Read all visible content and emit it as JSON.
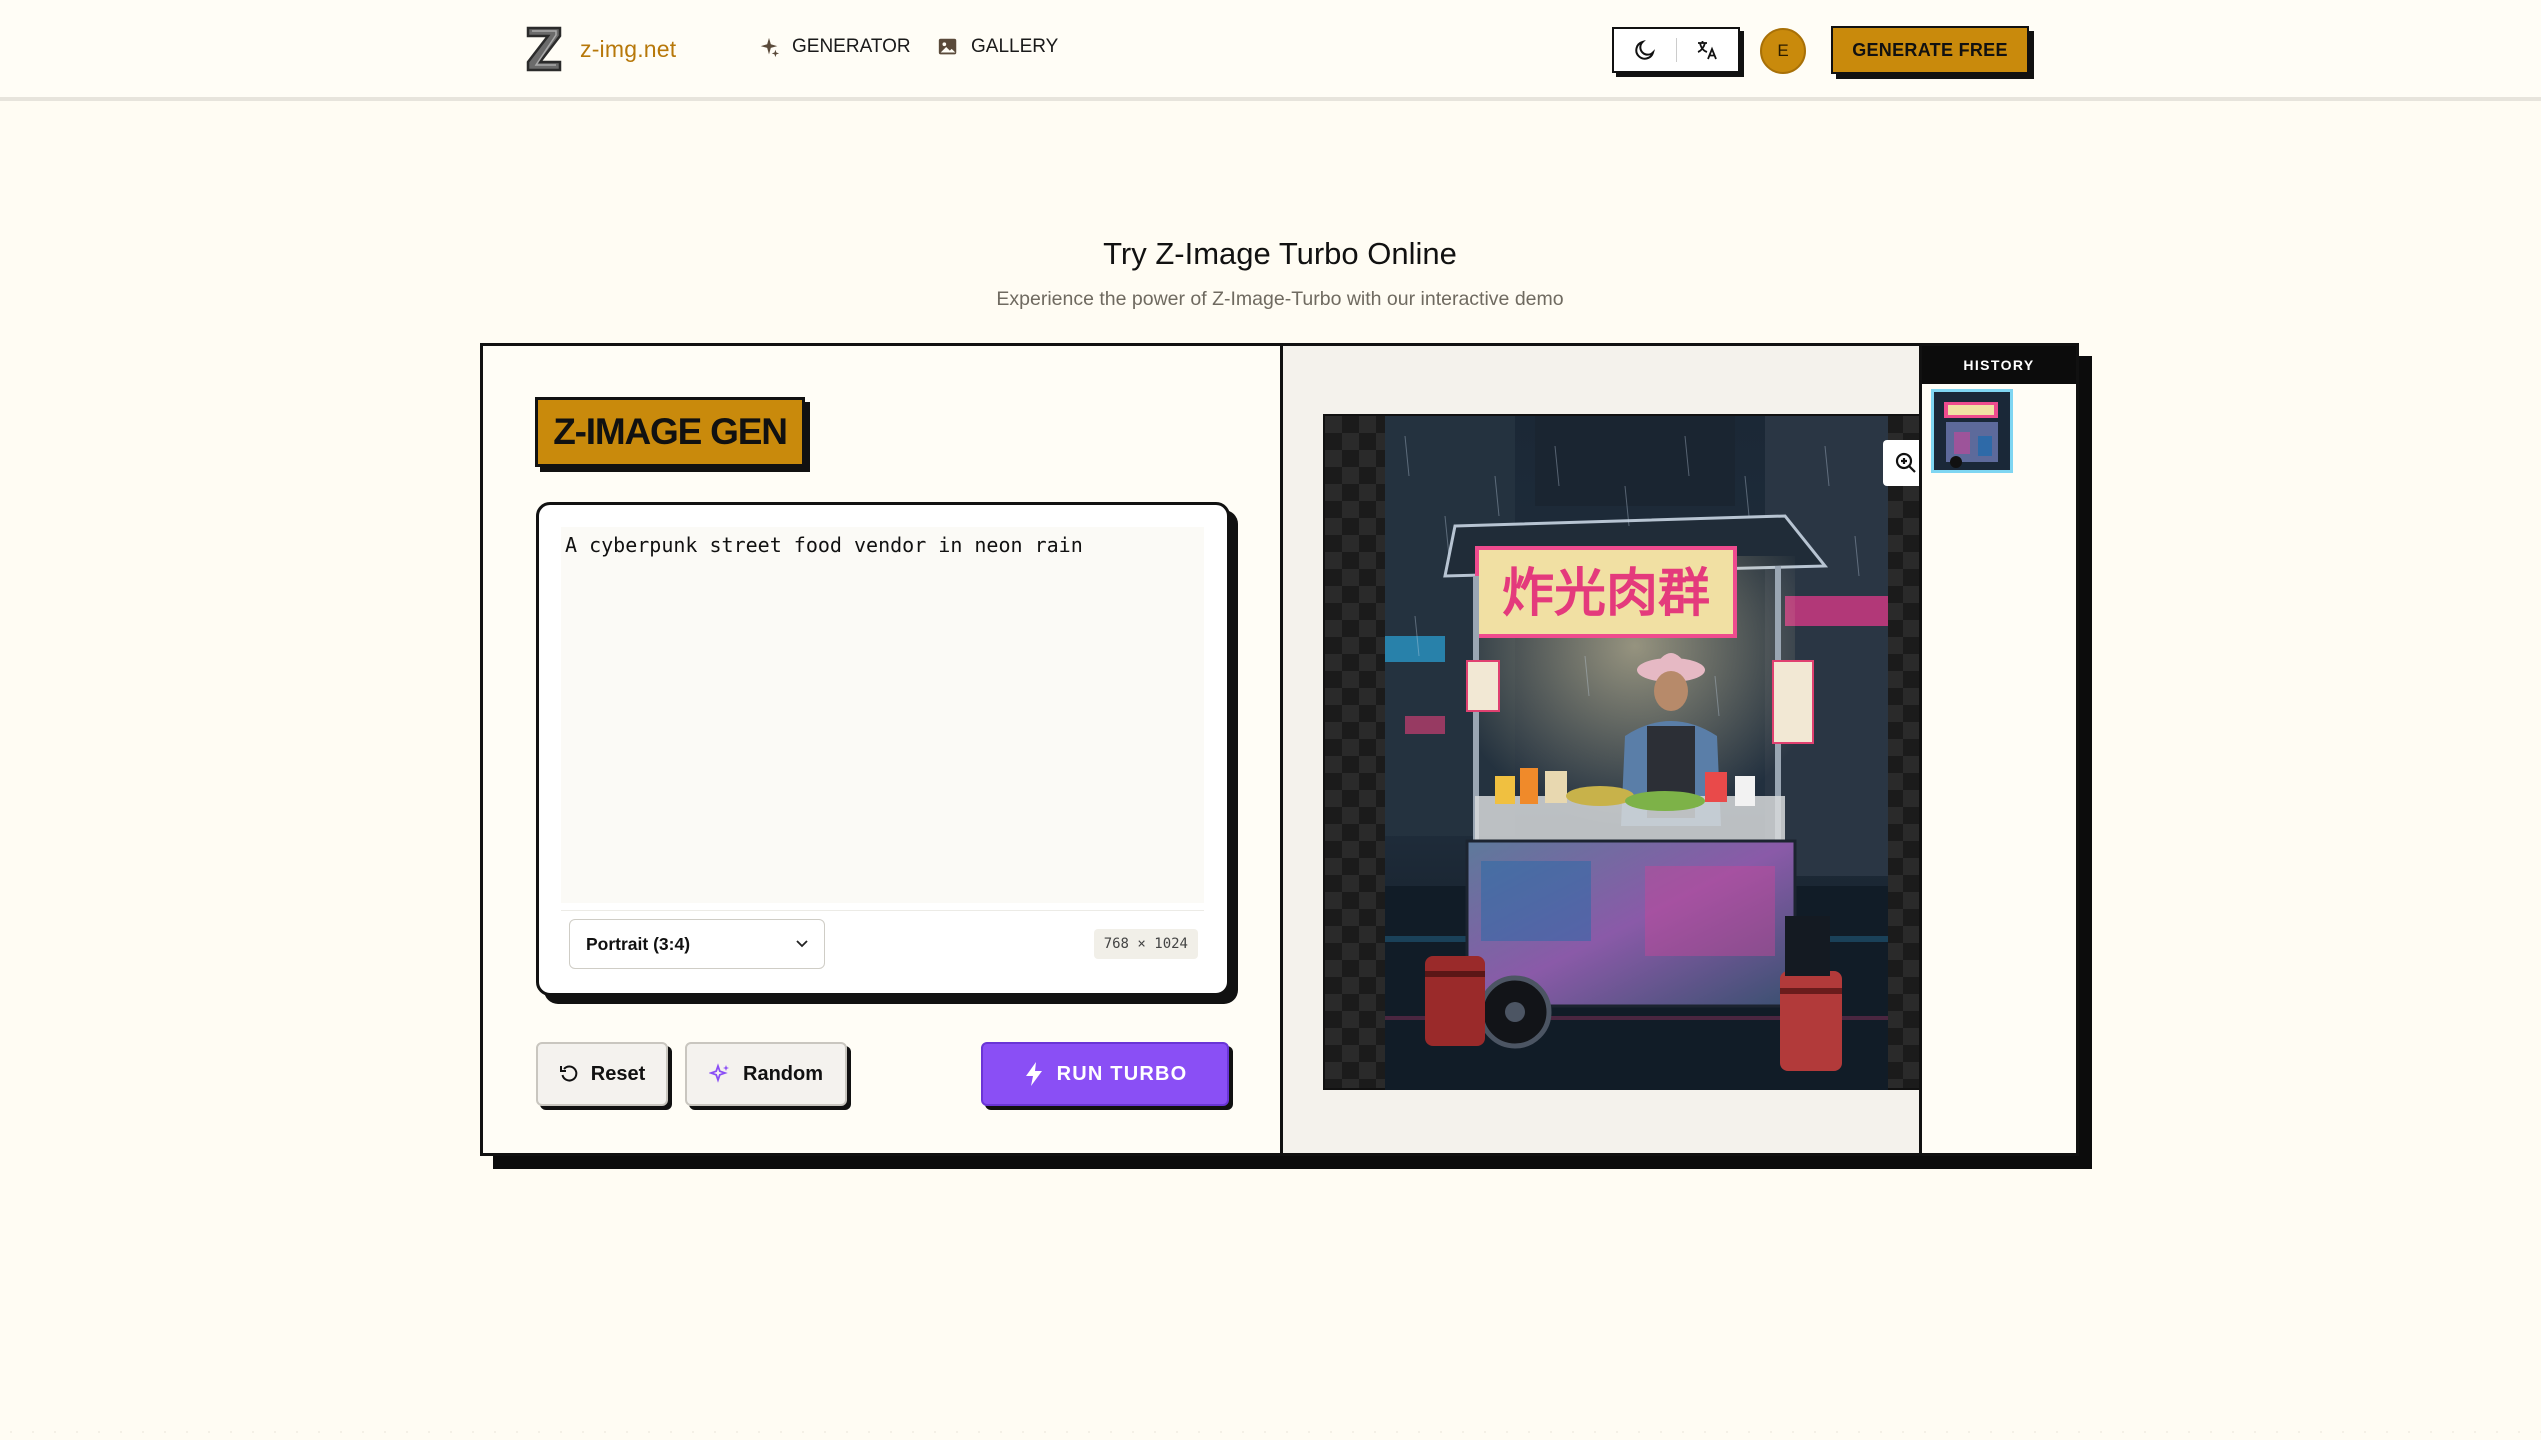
{
  "header": {
    "logo_text": "z-img.net",
    "nav": [
      {
        "label": "GENERATOR",
        "icon": "sparkle-icon"
      },
      {
        "label": "GALLERY",
        "icon": "image-icon"
      }
    ],
    "theme_toggle_icon": "moon-icon",
    "language_icon": "translate-icon",
    "avatar_initial": "E",
    "cta_label": "GENERATE FREE"
  },
  "hero": {
    "title": "Try Z-Image Turbo Online",
    "subtitle": "Experience the power of Z-Image-Turbo with our interactive demo"
  },
  "generator": {
    "badge": "Z-IMAGE GEN",
    "prompt_value": "A cyberpunk street food vendor in neon rain",
    "aspect_ratio": "Portrait (3:4)",
    "dimensions": "768 × 1024",
    "reset_label": "Reset",
    "random_label": "Random",
    "run_label": "RUN TURBO"
  },
  "preview": {
    "sign_text": "炸光肉群",
    "zoom_icon": "zoom-in-icon"
  },
  "history": {
    "label": "HISTORY"
  },
  "colors": {
    "accent": "#c98a0c",
    "run_button": "#8a4ff5",
    "background": "#fffcf3",
    "thumb_border": "#7fd6f2"
  }
}
